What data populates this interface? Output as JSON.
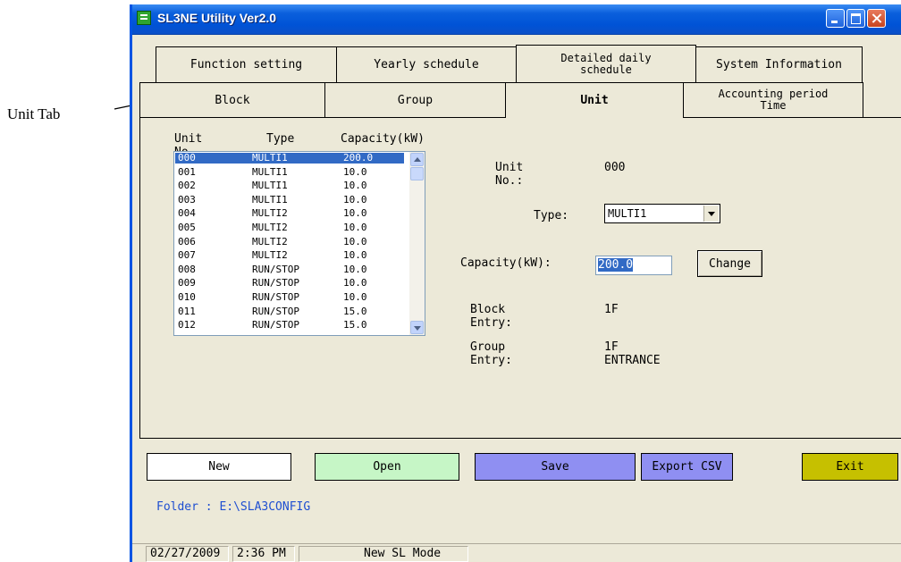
{
  "annotation": {
    "label": "Unit Tab"
  },
  "window": {
    "title": "SL3NE Utility Ver2.0"
  },
  "tabs_row1": [
    {
      "label": "Function setting"
    },
    {
      "label": "Yearly schedule"
    },
    {
      "label": "Detailed daily schedule"
    },
    {
      "label": "System Information"
    }
  ],
  "tabs_row2": [
    {
      "label": "Block"
    },
    {
      "label": "Group"
    },
    {
      "label": "Unit"
    },
    {
      "label": "Accounting period Time"
    }
  ],
  "active_tab": "Unit",
  "unit_list": {
    "headers": {
      "unit_no": "Unit No.",
      "type": "Type",
      "capacity": "Capacity(kW)"
    },
    "rows": [
      {
        "no": "000",
        "type": "MULTI1",
        "cap": "200.0",
        "selected": true
      },
      {
        "no": "001",
        "type": "MULTI1",
        "cap": "10.0"
      },
      {
        "no": "002",
        "type": "MULTI1",
        "cap": "10.0"
      },
      {
        "no": "003",
        "type": "MULTI1",
        "cap": "10.0"
      },
      {
        "no": "004",
        "type": "MULTI2",
        "cap": "10.0"
      },
      {
        "no": "005",
        "type": "MULTI2",
        "cap": "10.0"
      },
      {
        "no": "006",
        "type": "MULTI2",
        "cap": "10.0"
      },
      {
        "no": "007",
        "type": "MULTI2",
        "cap": "10.0"
      },
      {
        "no": "008",
        "type": "RUN/STOP",
        "cap": "10.0"
      },
      {
        "no": "009",
        "type": "RUN/STOP",
        "cap": "10.0"
      },
      {
        "no": "010",
        "type": "RUN/STOP",
        "cap": "10.0"
      },
      {
        "no": "011",
        "type": "RUN/STOP",
        "cap": "15.0"
      },
      {
        "no": "012",
        "type": "RUN/STOP",
        "cap": "15.0"
      }
    ]
  },
  "details": {
    "unit_no_label": "Unit No.:",
    "unit_no_value": "000",
    "type_label": "Type:",
    "type_value": "MULTI1",
    "capacity_label": "Capacity(kW):",
    "capacity_value": "200.0",
    "change_label": "Change",
    "block_label": "Block Entry:",
    "block_value": "1F",
    "group_label": "Group Entry:",
    "group_value": "1F ENTRANCE"
  },
  "buttons": {
    "new": "New",
    "open": "Open",
    "save": "Save",
    "export": "Export CSV",
    "exit": "Exit"
  },
  "folder": "Folder : E:\\SLA3CONFIG",
  "status": {
    "date": "02/27/2009",
    "time": "2:36 PM",
    "mode": "New SL Mode"
  },
  "colors": {
    "title_bar": "#0053d6",
    "selection": "#316ac5",
    "new_button": "#ffffff",
    "open_button": "#c6f6c6",
    "save_button": "#8f8ff2",
    "export_button": "#8f8ff2",
    "exit_button": "#c6c000",
    "folder_text": "#1f4fd1"
  }
}
